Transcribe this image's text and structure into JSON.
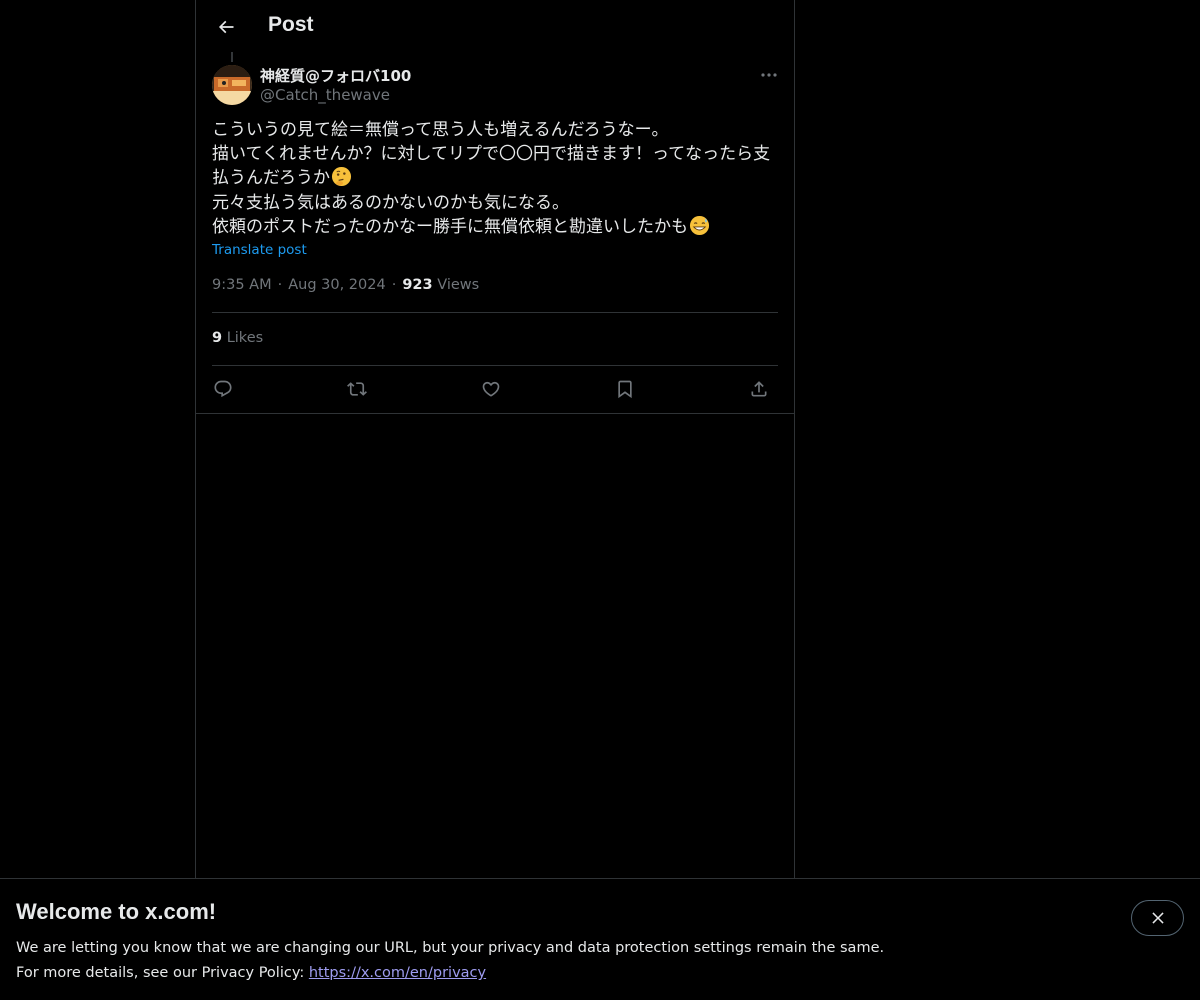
{
  "header": {
    "title": "Post"
  },
  "post": {
    "author_name": "神経質@フォロバ100",
    "author_handle": "@Catch_thewave",
    "lines": [
      "こういうの見て絵＝無償って思う人も増えるんだろうなー。",
      "描いてくれませんか？に対してリプで〇〇円で描きます！ってなったら支",
      "払うんだろうか",
      "元々支払う気はあるのかないのかも気になる。",
      "依頼のポストだったのかなー勝手に無償依頼と勘違いしたかも"
    ],
    "emojis": [
      "thinking-face-emoji",
      "grinning-sweat-emoji"
    ],
    "translate_label": "Translate post",
    "time": "9:35 AM",
    "separator": "·",
    "date": "Aug 30, 2024",
    "views_count": "923",
    "views_label": "Views",
    "likes_count": "9",
    "likes_label": "Likes"
  },
  "actions": [
    "reply-icon",
    "repost-icon",
    "like-icon",
    "bookmark-icon",
    "share-icon"
  ],
  "banner": {
    "title": "Welcome to x.com!",
    "line1": "We are letting you know that we are changing our URL, but your privacy and data protection settings remain the same.",
    "line2_prefix": "For more details, see our Privacy Policy: ",
    "link": "https://x.com/en/privacy"
  },
  "colors": {
    "background": "#000000",
    "text": "#e7e9ea",
    "muted": "#71767b",
    "link": "#1d9bf0",
    "border": "#2f3336"
  }
}
